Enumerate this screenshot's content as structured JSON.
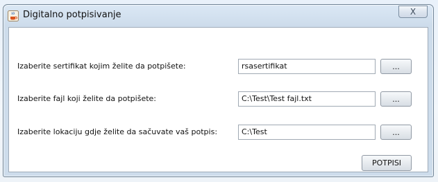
{
  "window": {
    "title": "Digitalno potpisivanje",
    "close_label": "X"
  },
  "rows": [
    {
      "label": "Izaberite sertifikat kojim želite da potpišete:",
      "value": "rsasertifikat",
      "browse_label": "..."
    },
    {
      "label": "Izaberite fajl koji želite da potpišete:",
      "value": "C:\\Test\\Test fajl.txt",
      "browse_label": "..."
    },
    {
      "label": "Izaberite lokaciju gdje želite da sačuvate vaš potpis:",
      "value": "C:\\Test",
      "browse_label": "..."
    }
  ],
  "actions": {
    "sign_label": "POTPISI"
  }
}
